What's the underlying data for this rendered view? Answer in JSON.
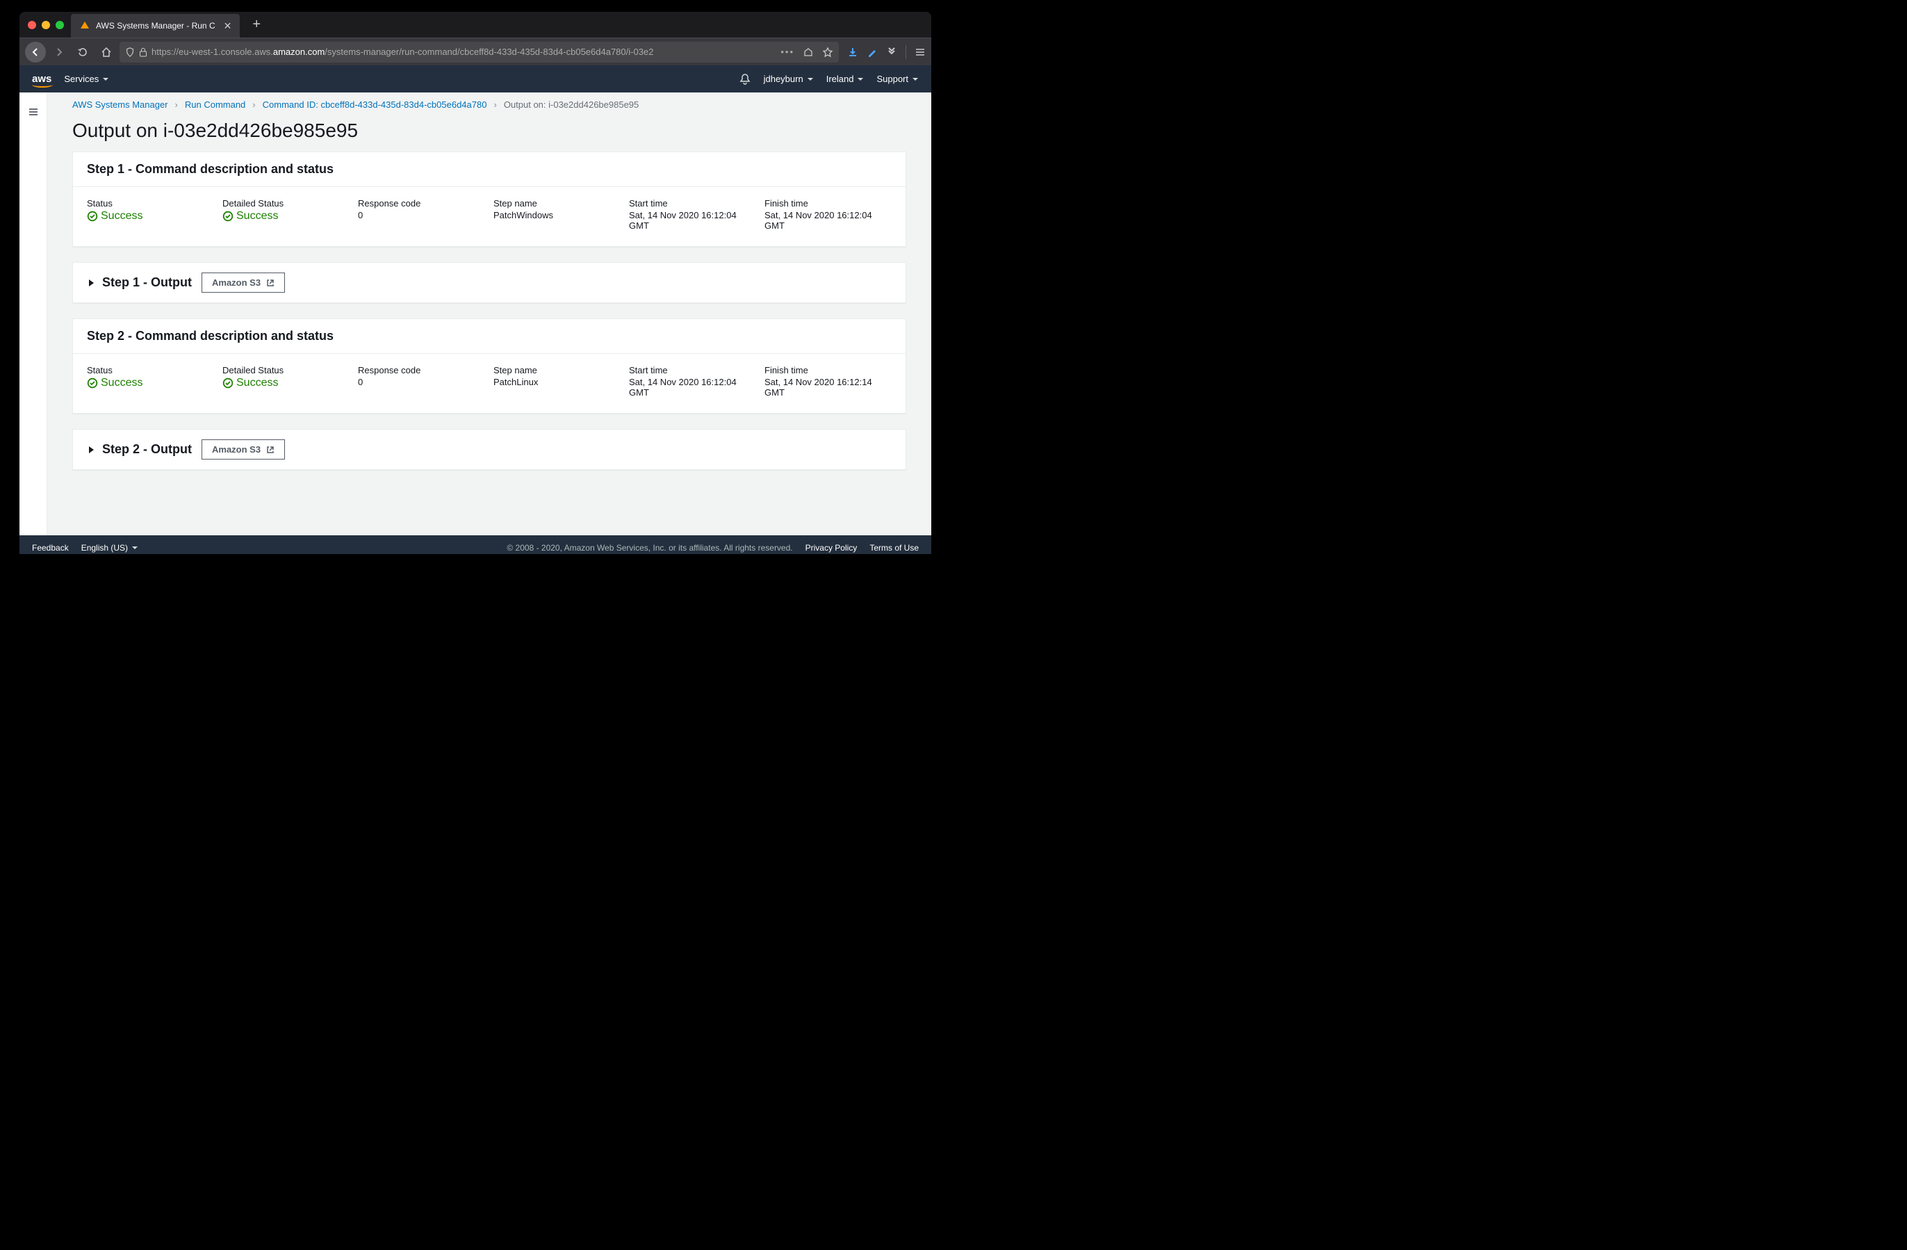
{
  "browser": {
    "tab_title": "AWS Systems Manager - Run C",
    "url_prefix": "https://eu-west-1.console.aws.",
    "url_domain": "amazon.com",
    "url_path": "/systems-manager/run-command/cbceff8d-433d-435d-83d4-cb05e6d4a780/i-03e2"
  },
  "topnav": {
    "logo": "aws",
    "services": "Services",
    "user": "jdheyburn",
    "region": "Ireland",
    "support": "Support"
  },
  "breadcrumbs": {
    "items": [
      {
        "label": "AWS Systems Manager",
        "link": true
      },
      {
        "label": "Run Command",
        "link": true
      },
      {
        "label": "Command ID: cbceff8d-433d-435d-83d4-cb05e6d4a780",
        "link": true
      },
      {
        "label": "Output on: i-03e2dd426be985e95",
        "link": false
      }
    ]
  },
  "page_title": "Output on i-03e2dd426be985e95",
  "steps": [
    {
      "header": "Step 1 - Command description and status",
      "status_label": "Status",
      "status_value": "Success",
      "detailed_label": "Detailed Status",
      "detailed_value": "Success",
      "response_label": "Response code",
      "response_value": "0",
      "name_label": "Step name",
      "name_value": "PatchWindows",
      "start_label": "Start time",
      "start_value": "Sat, 14 Nov 2020 16:12:04 GMT",
      "finish_label": "Finish time",
      "finish_value": "Sat, 14 Nov 2020 16:12:04 GMT",
      "output_header": "Step 1 - Output",
      "s3_label": "Amazon S3"
    },
    {
      "header": "Step 2 - Command description and status",
      "status_label": "Status",
      "status_value": "Success",
      "detailed_label": "Detailed Status",
      "detailed_value": "Success",
      "response_label": "Response code",
      "response_value": "0",
      "name_label": "Step name",
      "name_value": "PatchLinux",
      "start_label": "Start time",
      "start_value": "Sat, 14 Nov 2020 16:12:04 GMT",
      "finish_label": "Finish time",
      "finish_value": "Sat, 14 Nov 2020 16:12:14 GMT",
      "output_header": "Step 2 - Output",
      "s3_label": "Amazon S3"
    }
  ],
  "footer": {
    "feedback": "Feedback",
    "language": "English (US)",
    "copyright": "© 2008 - 2020, Amazon Web Services, Inc. or its affiliates. All rights reserved.",
    "privacy": "Privacy Policy",
    "terms": "Terms of Use"
  }
}
